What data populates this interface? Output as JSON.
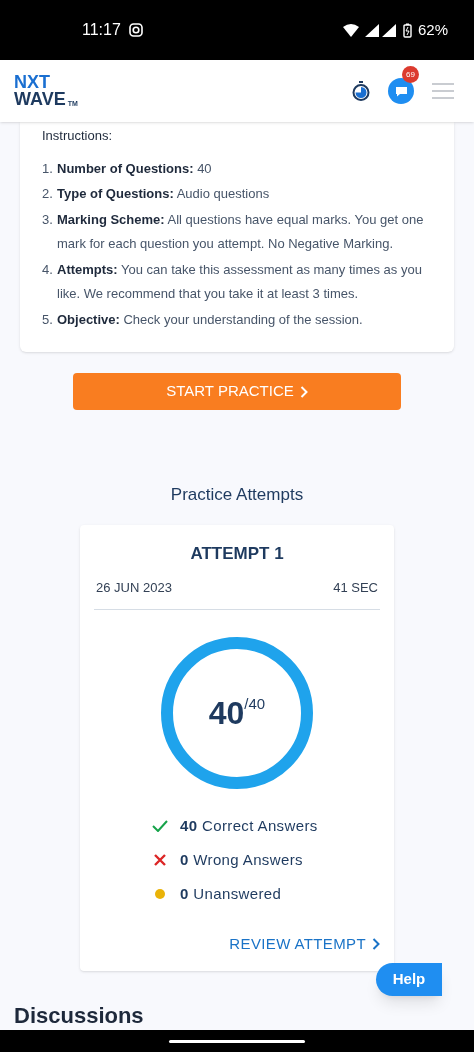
{
  "status_bar": {
    "time": "11:17",
    "battery": "62%"
  },
  "header": {
    "logo_line_1": "NXT",
    "logo_line_2": "WAVE",
    "logo_mark": "TM",
    "chat_badge": "69"
  },
  "instructions": {
    "title": "Instructions:",
    "items": [
      {
        "number": "1.",
        "label": "Number of Questions:",
        "text": "40"
      },
      {
        "number": "2.",
        "label": "Type of Questions:",
        "text": "Audio questions"
      },
      {
        "number": "3.",
        "label": "Marking Scheme:",
        "text": "All questions have equal marks. You get one mark for each question you attempt. No Negative Marking."
      },
      {
        "number": "4.",
        "label": "Attempts:",
        "text": "You can take this assessment as many times as you like. We recommend that you take it at least 3 times."
      },
      {
        "number": "5.",
        "label": "Objective:",
        "text": "Check your understanding of the session."
      }
    ]
  },
  "start_button": {
    "label": "START PRACTICE"
  },
  "attempts": {
    "title": "Practice Attempts",
    "cards": [
      {
        "title": "ATTEMPT 1",
        "date": "26 JUN 2023",
        "duration": "41 SEC",
        "score": "40",
        "total": "/40",
        "level": 1,
        "stats": [
          {
            "kind": "correct",
            "count": "40",
            "label": "Correct Answers"
          },
          {
            "kind": "wrong",
            "count": "0",
            "label": "Wrong Answers"
          },
          {
            "kind": "unanswered",
            "count": "0",
            "label": "Unanswered"
          }
        ],
        "review": "REVIEW ATTEMPT"
      }
    ]
  },
  "help_button": {
    "label": "Help"
  },
  "discussions": {
    "title": "Discussions"
  }
}
